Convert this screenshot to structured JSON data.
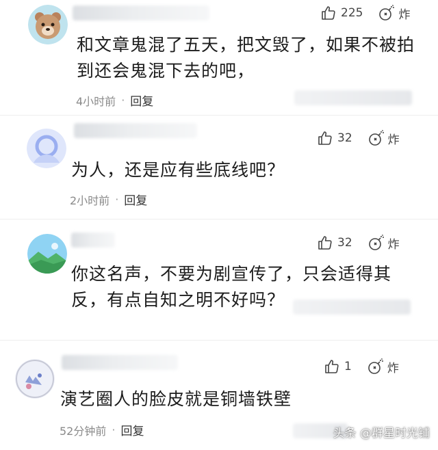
{
  "comments": [
    {
      "avatar_icon": "bear-avatar-icon",
      "text": "和文章鬼混了五天，把文毁了，如果不被拍到还会鬼混下去的吧，",
      "time": "4小时前",
      "sep": "·",
      "reply_label": "回复",
      "likes": "225",
      "bomb_label": "炸"
    },
    {
      "avatar_icon": "default-user-avatar-icon",
      "text": "为人，还是应有些底线吧？",
      "time": "2小时前",
      "sep": "·",
      "reply_label": "回复",
      "likes": "32",
      "bomb_label": "炸"
    },
    {
      "avatar_icon": "landscape-avatar-icon",
      "text": "你这名声，不要为剧宣传了，只会适得其反，有点自知之明不好吗？",
      "likes": "32",
      "bomb_label": "炸"
    },
    {
      "avatar_icon": "cartoon-avatar-icon",
      "text": "演艺圈人的脸皮就是铜墙铁壁",
      "time": "52分钟前",
      "sep": "·",
      "reply_label": "回复",
      "likes": "1",
      "bomb_label": "炸"
    }
  ],
  "watermark": "头条 @群星时光铺",
  "colors": {
    "text": "#1c1c1c",
    "meta": "#8a8a8a",
    "icon": "#444444"
  }
}
